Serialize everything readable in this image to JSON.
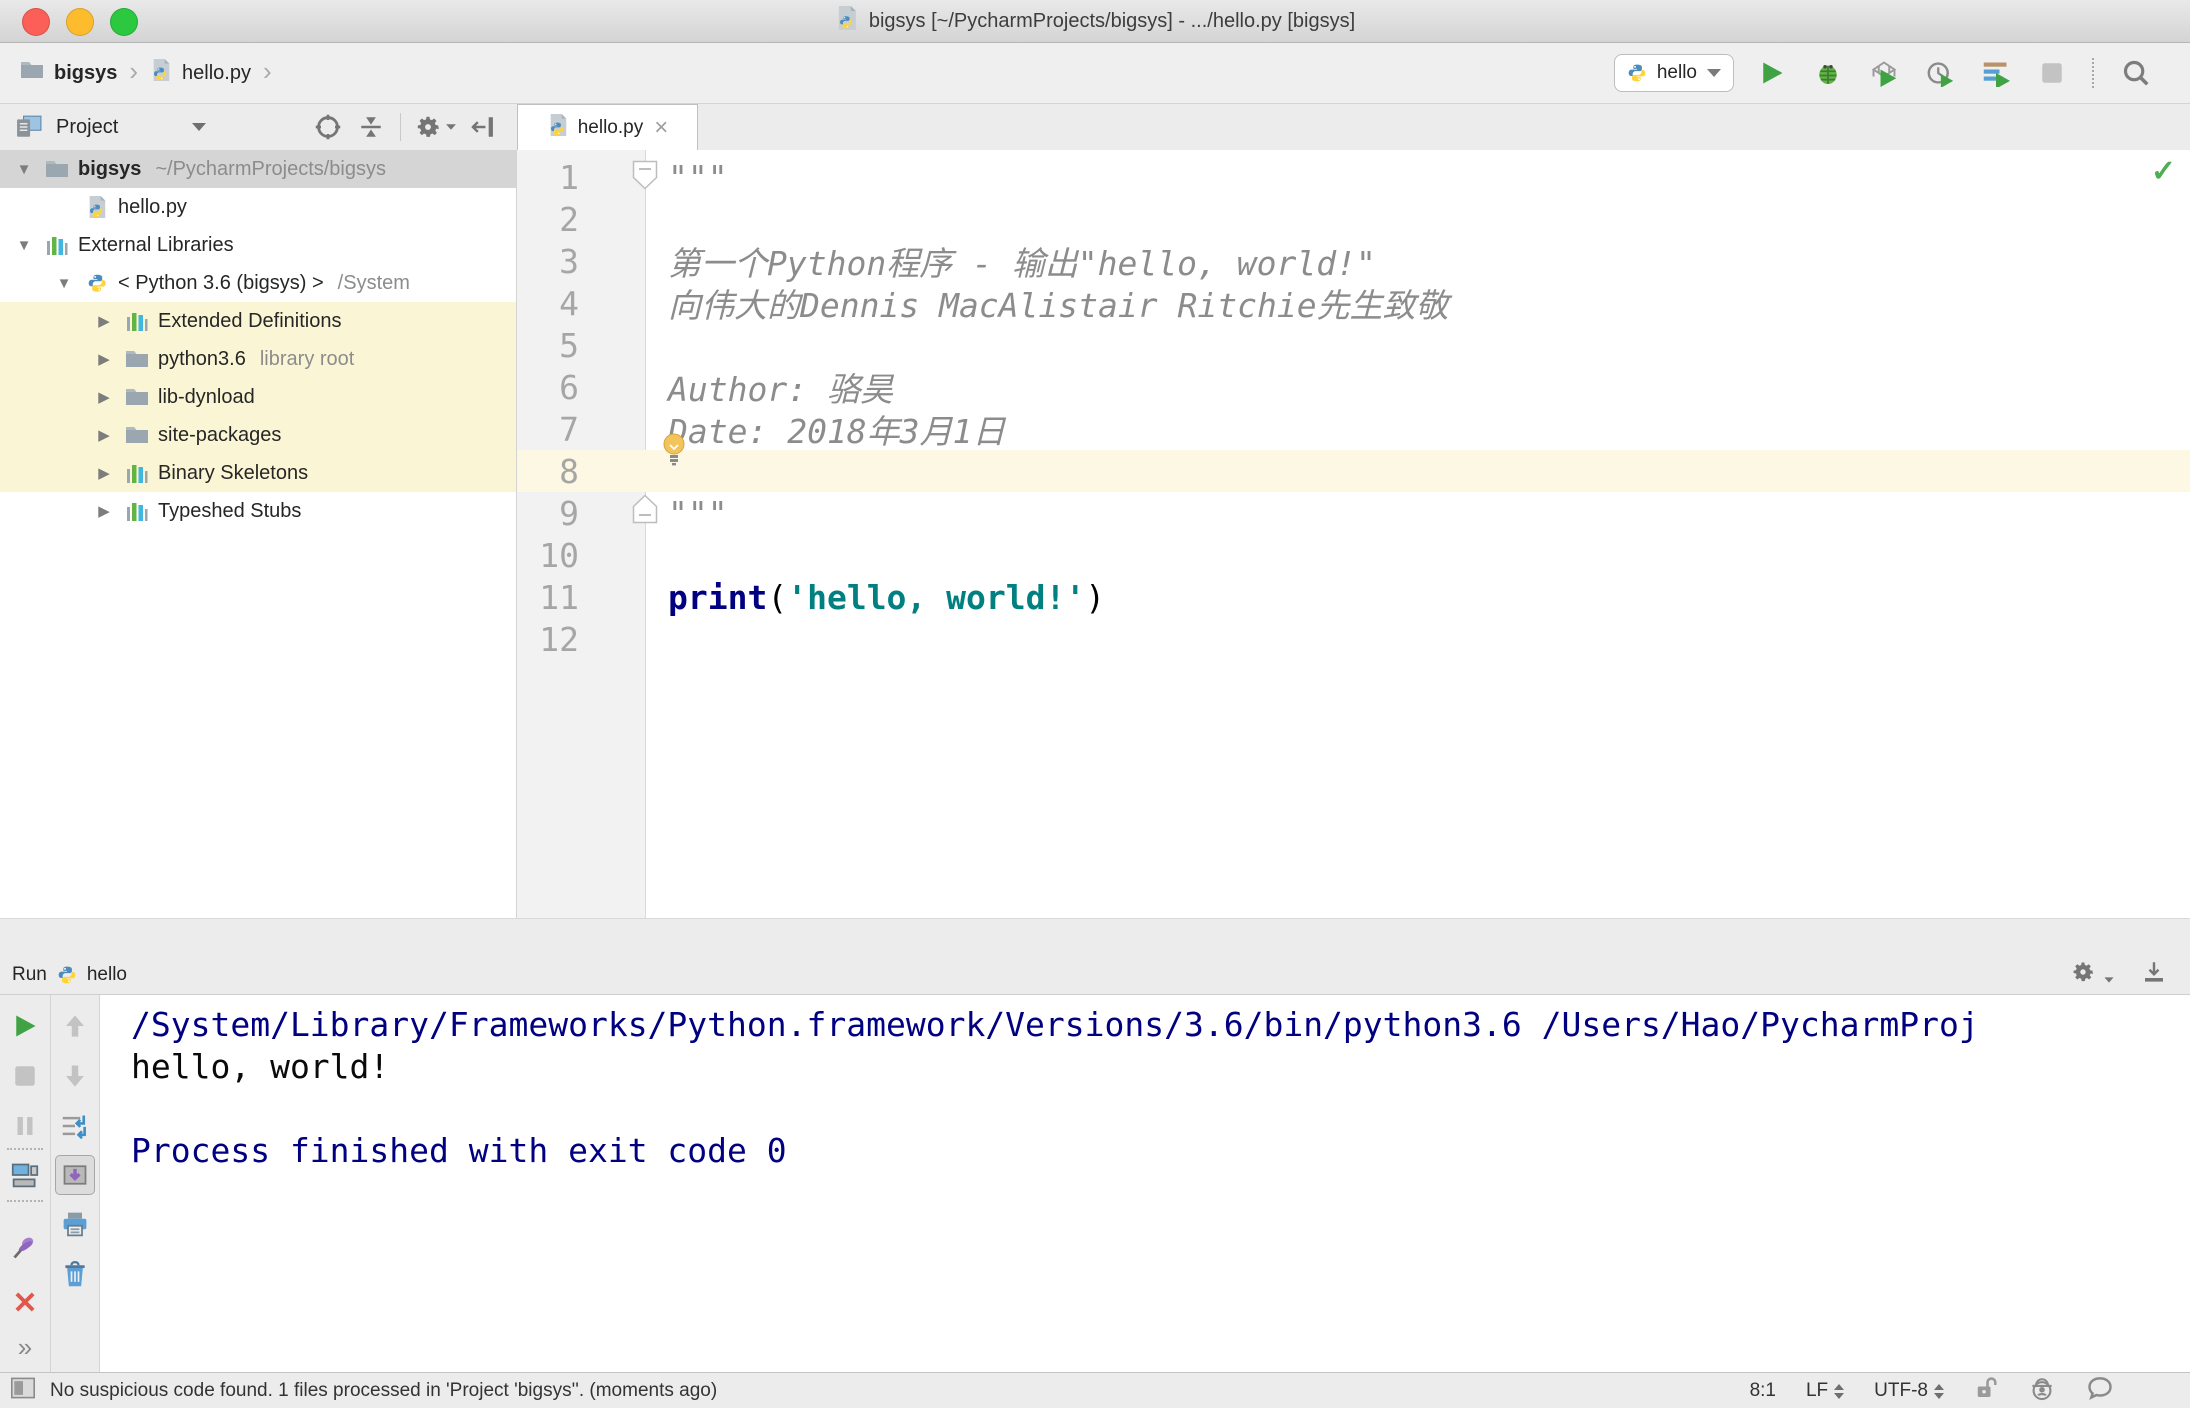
{
  "titlebar": {
    "title": "bigsys [~/PycharmProjects/bigsys] - .../hello.py [bigsys]"
  },
  "navbar": {
    "breadcrumbs": [
      {
        "label": "bigsys"
      },
      {
        "label": "hello.py"
      }
    ],
    "run_config": "hello",
    "icons": [
      "run",
      "debug",
      "run-with-coverage",
      "profile",
      "concurrency-diagram",
      "stop",
      "search-everywhere"
    ]
  },
  "project": {
    "title": "Project",
    "tree": [
      {
        "arrow": "expanded",
        "icon": "folder",
        "label": "bigsys",
        "bold": true,
        "suffix": "~/PycharmProjects/bigsys",
        "indent": 0,
        "state": "selected"
      },
      {
        "arrow": "none",
        "icon": "pyfile",
        "label": "hello.py",
        "indent": 1,
        "state": ""
      },
      {
        "arrow": "expanded",
        "icon": "lib",
        "label": "External Libraries",
        "indent": 0,
        "state": ""
      },
      {
        "arrow": "expanded",
        "icon": "python",
        "label": "< Python 3.6 (bigsys) >",
        "suffix": "/System",
        "indent": 1,
        "state": ""
      },
      {
        "arrow": "collapsed",
        "icon": "lib",
        "label": "Extended Definitions",
        "indent": 2,
        "state": "yellow"
      },
      {
        "arrow": "collapsed",
        "icon": "folder",
        "label": "python3.6",
        "suffix": "library root",
        "indent": 2,
        "state": "yellow"
      },
      {
        "arrow": "collapsed",
        "icon": "folder",
        "label": "lib-dynload",
        "indent": 2,
        "state": "yellow"
      },
      {
        "arrow": "collapsed",
        "icon": "folder",
        "label": "site-packages",
        "indent": 2,
        "state": "yellow"
      },
      {
        "arrow": "collapsed",
        "icon": "lib",
        "label": "Binary Skeletons",
        "indent": 2,
        "state": "yellow"
      },
      {
        "arrow": "collapsed",
        "icon": "lib",
        "label": "Typeshed Stubs",
        "indent": 2,
        "state": ""
      }
    ]
  },
  "editor": {
    "tab": "hello.py",
    "tab_close": "×",
    "inspection_status": "✓",
    "lines": [
      {
        "n": "1",
        "spans": [
          {
            "t": "\"\"\"",
            "c": "doc"
          }
        ],
        "fold": "start"
      },
      {
        "n": "2",
        "spans": []
      },
      {
        "n": "3",
        "spans": [
          {
            "t": "第一个Python程序 - 输出\"hello, world!\"",
            "c": "doc"
          }
        ]
      },
      {
        "n": "4",
        "spans": [
          {
            "t": "向伟大的Dennis MacAlistair Ritchie先生致敬",
            "c": "doc"
          }
        ]
      },
      {
        "n": "5",
        "spans": []
      },
      {
        "n": "6",
        "spans": [
          {
            "t": "Author: 骆昊",
            "c": "doc"
          }
        ]
      },
      {
        "n": "7",
        "spans": [
          {
            "t": "Date: 2018年3月1日",
            "c": "doc"
          }
        ],
        "bulb": true
      },
      {
        "n": "8",
        "spans": [],
        "current": true
      },
      {
        "n": "9",
        "spans": [
          {
            "t": "\"\"\"",
            "c": "doc"
          }
        ],
        "fold": "end"
      },
      {
        "n": "10",
        "spans": []
      },
      {
        "n": "11",
        "spans": [
          {
            "t": "print",
            "c": "kw"
          },
          {
            "t": "(",
            "c": "plain"
          },
          {
            "t": "'hello, world!'",
            "c": "str"
          },
          {
            "t": ")",
            "c": "plain"
          }
        ]
      },
      {
        "n": "12",
        "spans": []
      }
    ]
  },
  "run": {
    "label": "Run",
    "config": "hello",
    "console": [
      {
        "t": "/System/Library/Frameworks/Python.framework/Versions/3.6/bin/python3.6 /Users/Hao/PycharmProj",
        "c": "sys"
      },
      {
        "t": "hello, world!",
        "c": "out"
      },
      {
        "t": "",
        "c": "out"
      },
      {
        "t": "Process finished with exit code 0",
        "c": "sys"
      }
    ]
  },
  "statusbar": {
    "message": "No suspicious code found. 1 files processed in 'Project 'bigsys''. (moments ago)",
    "caret": "8:1",
    "line_sep": "LF",
    "encoding": "UTF-8"
  },
  "colors": {
    "keyword": "#000080",
    "string": "#008080",
    "docstring": "#8c8c8c",
    "console_system": "#000080",
    "current_line": "#fcf8e3",
    "tree_highlight": "#faf6d5",
    "run_green": "#3fa344"
  }
}
